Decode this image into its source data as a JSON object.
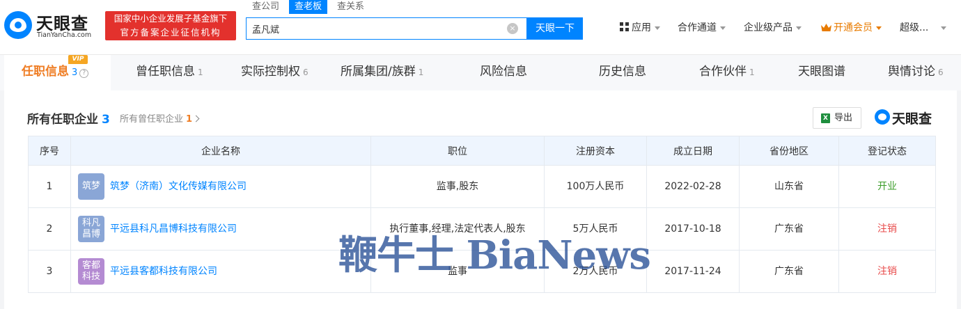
{
  "logo": {
    "name": "天眼查",
    "domain": "TianYanCha.com"
  },
  "banner": {
    "line1": "国家中小企业发展子基金旗下",
    "line2": "官方备案企业征信机构"
  },
  "search": {
    "tabs": [
      "查公司",
      "查老板",
      "查关系"
    ],
    "active_tab": "查老板",
    "value": "孟凡斌",
    "button": "天眼一下"
  },
  "nav": {
    "apps": "应用",
    "partner": "合作通道",
    "enterprise": "企业级产品",
    "vip": "开通会员",
    "super": "超级..."
  },
  "tabs": [
    {
      "label": "任职信息",
      "count": "3",
      "vip": "VIP"
    },
    {
      "label": "曾任职信息",
      "count": "1"
    },
    {
      "label": "实际控制权",
      "count": "6"
    },
    {
      "label": "所属集团/族群",
      "count": "1"
    },
    {
      "label": "风险信息",
      "count": ""
    },
    {
      "label": "历史信息",
      "count": ""
    },
    {
      "label": "合作伙伴",
      "count": "1"
    },
    {
      "label": "天眼图谱",
      "count": ""
    },
    {
      "label": "舆情讨论",
      "count": "6"
    }
  ],
  "section": {
    "title": "所有任职企业",
    "count": "3",
    "sub_label": "所有曾任职企业",
    "sub_count": "1",
    "export": "导出",
    "brand": "天眼查"
  },
  "table": {
    "headers": [
      "序号",
      "企业名称",
      "职位",
      "注册资本",
      "成立日期",
      "省份地区",
      "登记状态"
    ],
    "rows": [
      {
        "index": "1",
        "logo_text": "筑梦",
        "logo_color": "#8aa6d6",
        "name": "筑梦（济南）文化传媒有限公司",
        "position": "监事,股东",
        "capital": "100万人民币",
        "date": "2022-02-28",
        "region": "山东省",
        "status": "开业",
        "status_color": "#3c9d2a"
      },
      {
        "index": "2",
        "logo_text": "科凡昌博",
        "logo_color": "#8aa6d6",
        "name": "平远县科凡昌博科技有限公司",
        "position": "执行董事,经理,法定代表人,股东",
        "capital": "5万人民币",
        "date": "2017-10-18",
        "region": "广东省",
        "status": "注销",
        "status_color": "#e84a4a"
      },
      {
        "index": "3",
        "logo_text": "客都科技",
        "logo_color": "#b48bd2",
        "name": "平远县客都科技有限公司",
        "position": "监事",
        "capital": "2万人民币",
        "date": "2017-11-24",
        "region": "广东省",
        "status": "注销",
        "status_color": "#e84a4a"
      }
    ]
  },
  "watermark": "鞭牛士 BiaNews"
}
